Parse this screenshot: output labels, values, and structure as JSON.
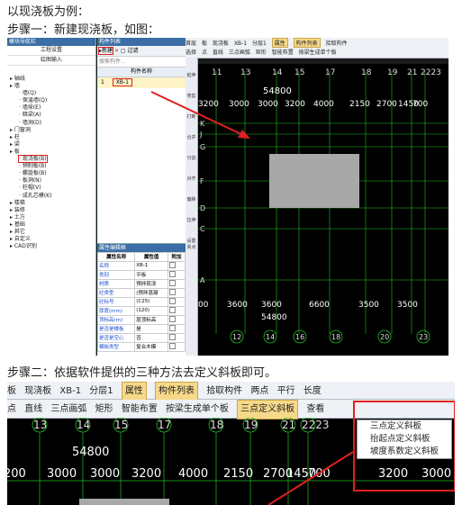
{
  "text": {
    "intro": "以现浇板为例：",
    "step1": "步骤一：新建现浇板，如图：",
    "step2": "步骤二：依据软件提供的三种方法去定义斜板即可。"
  },
  "shot1": {
    "nav": {
      "title": "模块导航栏",
      "buttons": [
        "工程设置",
        "绘图输入"
      ],
      "tree": [
        "轴线",
        "墙",
        "墙(Q)",
        "保温墙(Q)",
        "墙垛(E)",
        "暗梁(A)",
        "墙洞(D)",
        "门窗洞",
        "柱",
        "梁",
        "板",
        "现浇板(B)",
        "预制板(B)",
        "螺旋板(B)",
        "板洞(N)",
        "柱帽(V)",
        "成孔芯模(K)",
        "楼梯",
        "装修",
        "土方",
        "基础",
        "其它",
        "自定义",
        "CAD识别"
      ]
    },
    "comp": {
      "title": "构件列表",
      "new_label": "新建",
      "filter_label": "过滤",
      "search_placeholder": "搜索构件...",
      "col_name": "构件名称",
      "row_index": "1",
      "row_name": "XB-1"
    },
    "prop": {
      "title": "属性编辑框",
      "headers": [
        "属性名称",
        "属性值",
        "附加"
      ],
      "rows": [
        [
          "名称",
          "XB-1"
        ],
        [
          "类别",
          "平板"
        ],
        [
          "材质",
          "预拌现浇"
        ],
        [
          "砼类型",
          "(预拌混凝"
        ],
        [
          "砼标号",
          "(C25)"
        ],
        [
          "厚度(mm)",
          "(120)"
        ],
        [
          "顶标高(m)",
          "层顶标高"
        ],
        [
          "是否是楼板",
          "是"
        ],
        [
          "是否是空心",
          "否"
        ],
        [
          "模板类型",
          "复合木模"
        ]
      ]
    },
    "toolbar": {
      "items": [
        "首层",
        "板",
        "现浇板",
        "XB-1",
        "分层1",
        "属性",
        "构件列表",
        "拾取构件"
      ],
      "items2": [
        "选择",
        "点",
        "直线",
        "三点画弧",
        "矩形",
        "智能布置",
        "按梁生成单个板"
      ]
    },
    "vtool": [
      "延伸",
      "修剪",
      "打断",
      "合并",
      "分割",
      "对齐",
      "偏移",
      "拉伸",
      "设置夹点"
    ],
    "axes_top": [
      "11",
      "13",
      "14",
      "15",
      "17",
      "18",
      "19",
      "21",
      "2223"
    ],
    "axes_bottom": [
      "12",
      "14",
      "16",
      "18",
      "20",
      "23"
    ],
    "dims_top": [
      "3200",
      "3000",
      "3000",
      "3200",
      "4000",
      "2150",
      "2700",
      "1450",
      "700"
    ],
    "dim_total_top": "54800",
    "dims_bottom": [
      "00",
      "3600",
      "3600",
      "6600",
      "3500",
      "3500"
    ],
    "dim_total_bottom": "54800",
    "rows_left": [
      "K",
      "J",
      "G",
      "F",
      "D",
      "C",
      "A"
    ]
  },
  "shot2": {
    "toolbar1": [
      "板",
      "现浇板",
      "XB-1",
      "分层1",
      "属性",
      "构件列表",
      "拾取构件",
      "两点",
      "平行",
      "长度"
    ],
    "toolbar2": [
      "点",
      "直线",
      "三点画弧",
      "矩形",
      "智能布置",
      "按梁生成单个板",
      "三点定义斜板",
      "查看"
    ],
    "menu": [
      "三点定义斜板",
      "抬起点定义斜板",
      "坡度系数定义斜板"
    ],
    "axes": [
      "13",
      "14",
      "15",
      "17",
      "18",
      "19",
      "21",
      "2223"
    ],
    "dim_total": "54800",
    "dims": [
      "200",
      "3000",
      "3000",
      "3200",
      "4000",
      "2150",
      "2700",
      "1450",
      "700",
      "3200",
      "3000"
    ]
  }
}
